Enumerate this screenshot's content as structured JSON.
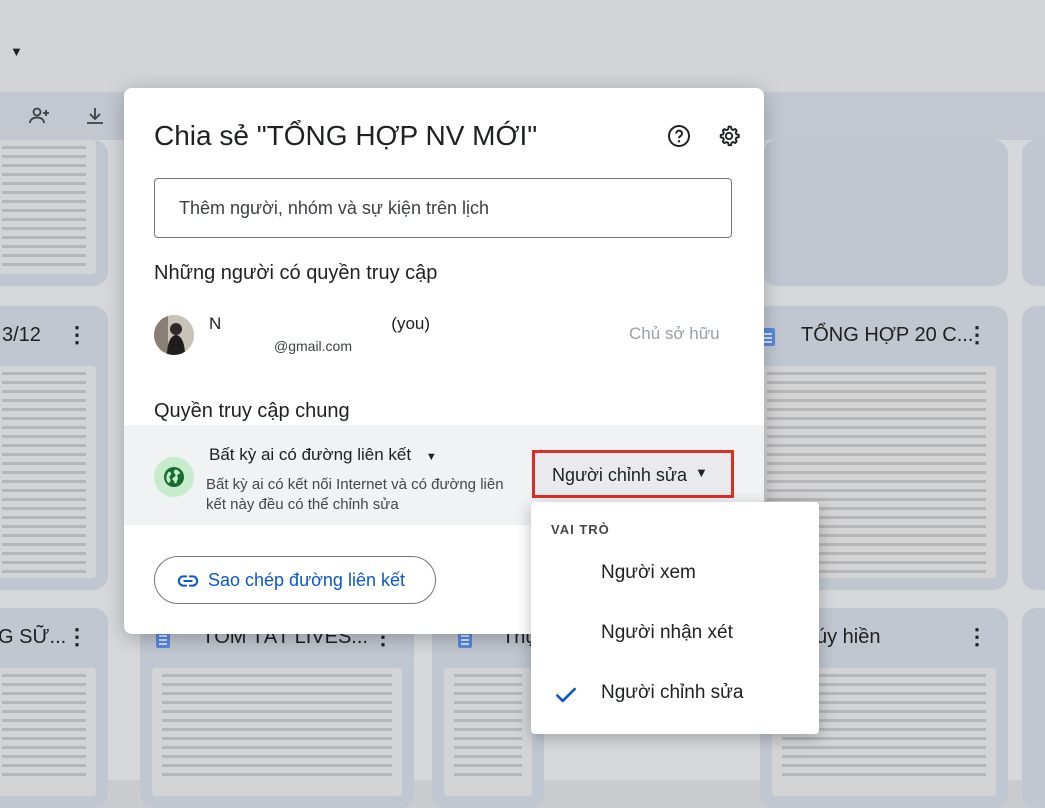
{
  "background": {
    "tiles": [
      {
        "title": "3/12"
      },
      {
        "title": "TỔNG HỢP 20 C..."
      },
      {
        "title": "G SỮ..."
      },
      {
        "title": "TÓM TẮT LIVES..."
      },
      {
        "title": "Thụ"
      },
      {
        "title": "úy hiền"
      }
    ]
  },
  "dialog": {
    "title": "Chia sẻ \"TỔNG HỢP NV MỚI\"",
    "add_people_placeholder": "Thêm người, nhóm và sự kiện trên lịch",
    "people_section_title": "Những người có quyền truy cập",
    "owner": {
      "name_suffix": "(you)",
      "name_initial": "N",
      "email": "@gmail.com",
      "role": "Chủ sở hữu"
    },
    "general_access_title": "Quyền truy cập chung",
    "general_access": {
      "scope": "Bất kỳ ai có đường liên kết",
      "description": "Bất kỳ ai có kết nối Internet và có đường liên kết này đều có thể chỉnh sửa",
      "role": "Người chỉnh sửa"
    },
    "copy_link_label": "Sao chép đường liên kết"
  },
  "role_menu": {
    "header": "VAI TRÒ",
    "items": [
      {
        "label": "Người xem",
        "selected": false
      },
      {
        "label": "Người nhận xét",
        "selected": false
      },
      {
        "label": "Người chỉnh sửa",
        "selected": true
      }
    ]
  },
  "colors": {
    "accent": "#0b57d0",
    "highlight_border": "#d93025",
    "globe_bg": "#c6eccb",
    "check": "#0b57d0"
  }
}
